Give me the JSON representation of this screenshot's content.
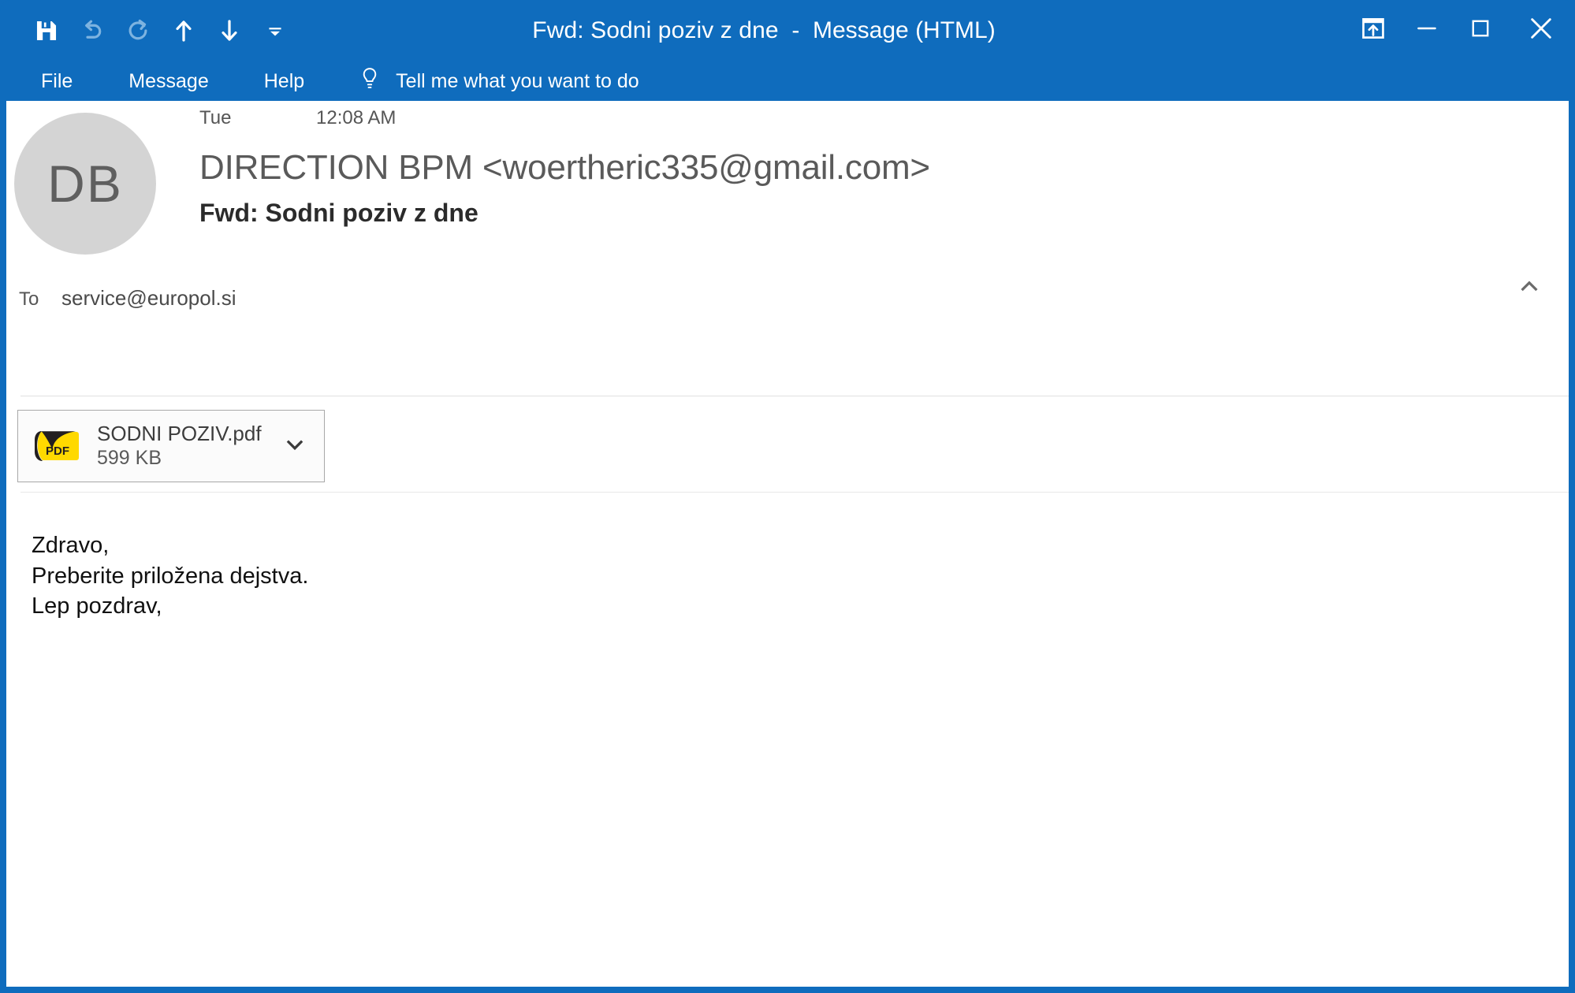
{
  "window": {
    "accent_color": "#0f6cbd",
    "title_subject": "Fwd: Sodni poziv z dne",
    "title_separator": "  -  ",
    "title_kind": "Message (HTML)"
  },
  "quick_access_toolbar": {
    "items": [
      {
        "name": "save-button",
        "icon": "save-icon",
        "label": "Save"
      },
      {
        "name": "undo-button",
        "icon": "undo-icon",
        "label": "Undo"
      },
      {
        "name": "redo-button",
        "icon": "redo-icon",
        "label": "Redo"
      },
      {
        "name": "previous-item-button",
        "icon": "arrow-up-icon",
        "label": "Previous Item"
      },
      {
        "name": "next-item-button",
        "icon": "arrow-down-icon",
        "label": "Next Item"
      },
      {
        "name": "customize-toolbar-button",
        "icon": "chevron-down-small-icon",
        "label": "Customize Quick Access Toolbar"
      }
    ]
  },
  "window_controls": {
    "restore_ribbon_label": "Ribbon Display Options",
    "minimize_label": "Minimize",
    "maximize_label": "Maximize",
    "close_label": "Close"
  },
  "ribbon": {
    "tabs": [
      {
        "label": "File"
      },
      {
        "label": "Message"
      },
      {
        "label": "Help"
      }
    ],
    "tell_me": {
      "icon": "lightbulb-icon",
      "label": "Tell me what you want to do"
    }
  },
  "message": {
    "avatar_initials": "DB",
    "date_day": "Tue",
    "date_time": "12:08 AM",
    "sender": "DIRECTION BPM <woertheric335@gmail.com>",
    "subject": "Fwd: Sodni poziv z dne",
    "to_label": "To",
    "to_value": "service@europol.si",
    "collapse_icon": "chevron-up-icon",
    "attachment": {
      "file_name": "SODNI POZIV.pdf",
      "file_size": "599 KB",
      "icon": "pdf-file-icon",
      "icon_label": "PDF",
      "dropdown_icon": "chevron-down-icon"
    },
    "body_lines": [
      "Zdravo,",
      "Preberite priložena dejstva.",
      "Lep pozdrav,"
    ]
  }
}
